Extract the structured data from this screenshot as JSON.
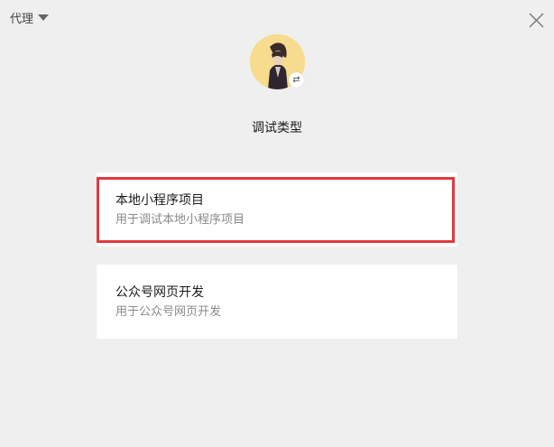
{
  "proxy": {
    "label": "代理"
  },
  "debug": {
    "title": "调试类型"
  },
  "cards": [
    {
      "name": "本地小程序项目",
      "desc": "用于调试本地小程序项目"
    },
    {
      "name": "公众号网页开发",
      "desc": "用于公众号网页开发"
    }
  ],
  "icons": {
    "proxy_dropdown": "caret-down-icon",
    "close": "close-icon",
    "switch_account": "switch-icon"
  },
  "colors": {
    "background": "#efefef",
    "card": "#ffffff",
    "highlight": "#e0393e",
    "avatar_bg": "#f6dc8c"
  }
}
